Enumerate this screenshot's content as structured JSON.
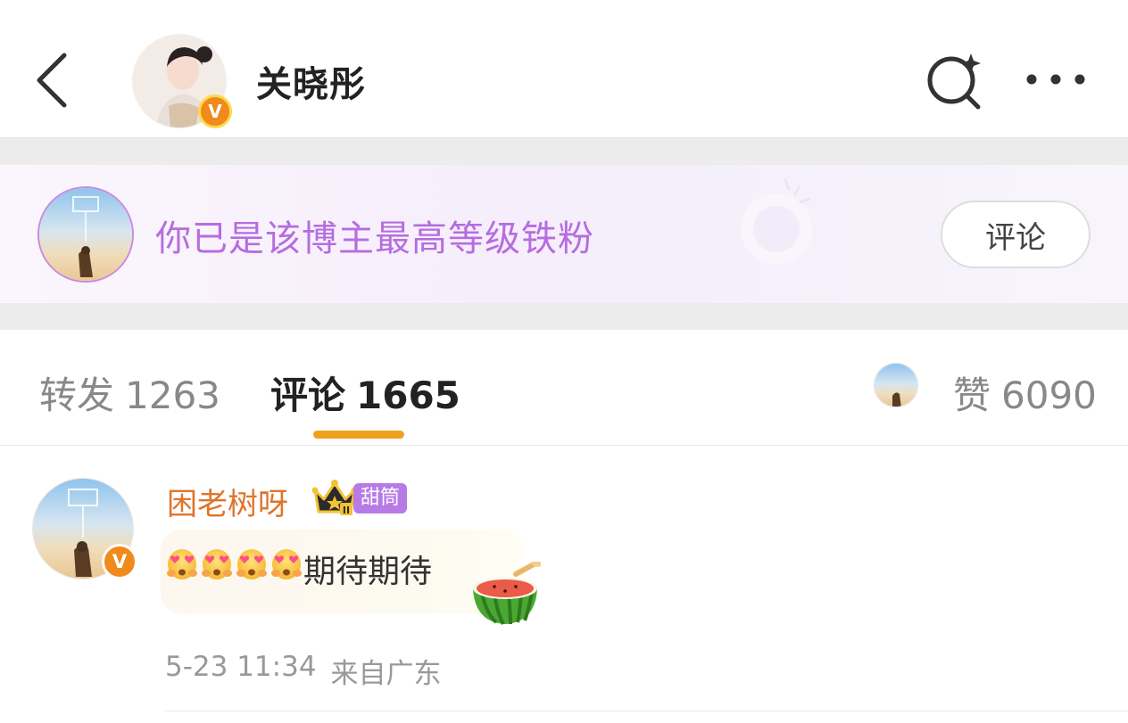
{
  "header": {
    "name": "关晓彤",
    "verified_badge": "V",
    "icons": {
      "back": "back-chevron-icon",
      "search": "search-sparkle-icon",
      "more": "more-dots-icon"
    }
  },
  "fan_banner": {
    "message": "你已是该博主最高等级铁粉",
    "comment_button": "评论"
  },
  "tabs": {
    "repost": {
      "label": "转发",
      "count": "1263"
    },
    "comments": {
      "label": "评论",
      "count": "1665",
      "active": true
    },
    "likes": {
      "label": "赞",
      "count": "6090"
    }
  },
  "comments": [
    {
      "username": "困老树呀",
      "verified_badge": "V",
      "crown_level": "II",
      "fan_tag": "甜筒",
      "emoji_icons": [
        "heart-eyes-emoji",
        "heart-eyes-emoji",
        "heart-eyes-emoji",
        "heart-eyes-emoji"
      ],
      "text": "期待期待",
      "sticker": "watermelon-sticker-icon",
      "time": "5-23 11:34",
      "location": "来自广东"
    }
  ],
  "colors": {
    "accent_orange": "#f0a020",
    "username_orange": "#e0742c",
    "fan_purple": "#b56de0",
    "tag_purple": "#b77be6",
    "verified_orange": "#f08a1c"
  }
}
